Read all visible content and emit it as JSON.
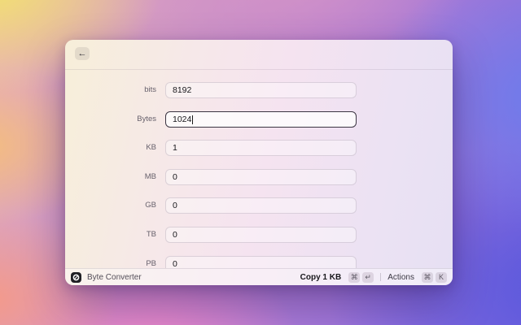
{
  "window": {
    "header": {
      "back_icon": "←"
    },
    "rows": [
      {
        "label": "bits",
        "value": "8192",
        "focused": false
      },
      {
        "label": "Bytes",
        "value": "1024",
        "focused": true
      },
      {
        "label": "KB",
        "value": "1",
        "focused": false
      },
      {
        "label": "MB",
        "value": "0",
        "focused": false
      },
      {
        "label": "GB",
        "value": "0",
        "focused": false
      },
      {
        "label": "TB",
        "value": "0",
        "focused": false
      },
      {
        "label": "PB",
        "value": "0",
        "focused": false
      }
    ],
    "footer": {
      "app_name": "Byte Converter",
      "primary_action": {
        "label": "Copy 1 KB",
        "keys": [
          "⌘",
          "↵"
        ]
      },
      "secondary_action": {
        "label": "Actions",
        "keys": [
          "⌘",
          "K"
        ]
      }
    }
  },
  "colors": {
    "focus_border": "#3b3542",
    "footer_icon_bg": "#202024",
    "bg_corners": {
      "top_left": "#f1e170",
      "bottom_left": "#f49a8a",
      "top_right": "#7a82e8",
      "bottom_right": "#5a58dc",
      "bottom_center": "#8f63c8"
    }
  }
}
